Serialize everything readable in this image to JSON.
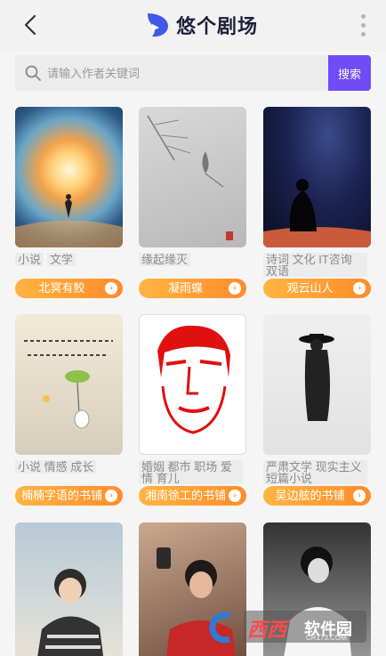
{
  "header": {
    "title": "悠个剧场",
    "back_icon": "chevron-left-icon",
    "menu_icon": "more-vertical-icon"
  },
  "search": {
    "placeholder": "请输入作者关键词",
    "button_label": "搜索"
  },
  "cards": [
    {
      "tags": [
        "小说",
        "文学"
      ],
      "author": "北冥有鲛"
    },
    {
      "tags": [
        "缘起缘灭"
      ],
      "author": "凝雨蝶"
    },
    {
      "tags": [
        "诗词 文化 IT咨询 双语"
      ],
      "author": "观云山人"
    },
    {
      "tags": [
        "小说 情感 成长"
      ],
      "author": "楠楠字语的书铺"
    },
    {
      "tags": [
        "婚姻 都市 职场 爱情 育儿"
      ],
      "author": "湘南徐工的书铺"
    },
    {
      "tags": [
        "严肃文学 现实主义 短篇小说"
      ],
      "author": "吴边舷的书铺"
    },
    {
      "tags": [],
      "author": ""
    },
    {
      "tags": [],
      "author": ""
    },
    {
      "tags": [],
      "author": ""
    }
  ],
  "watermark": {
    "text": "西西",
    "sub": "软件园",
    "url": "CR173.COM"
  },
  "colors": {
    "accent": "#6f4cf5",
    "chip_start": "#ffb441",
    "chip_end": "#ff8c2a"
  }
}
